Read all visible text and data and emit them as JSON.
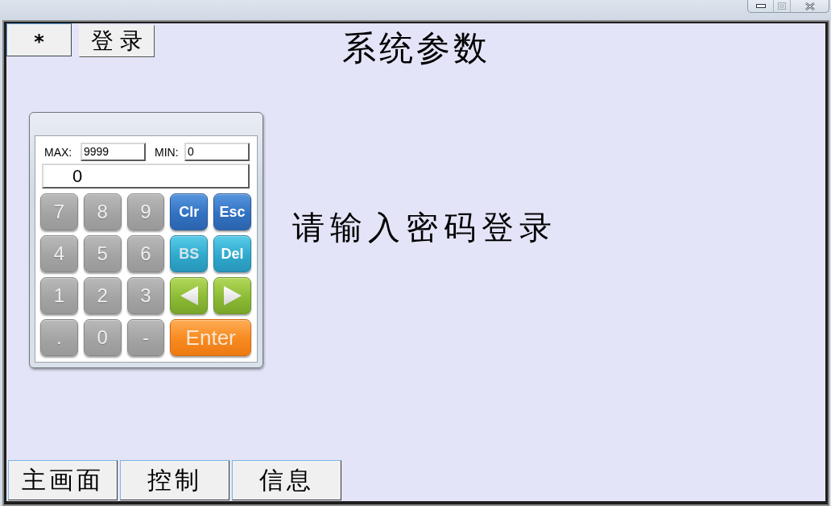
{
  "header": {
    "star_button": "*",
    "login_button": "登录",
    "title": "系统参数"
  },
  "keypad": {
    "max_label": "MAX:",
    "max_value": "9999",
    "min_label": "MIN:",
    "min_value": "0",
    "display": "0",
    "keys": [
      {
        "kind": "digit",
        "label": "7"
      },
      {
        "kind": "digit",
        "label": "8"
      },
      {
        "kind": "digit",
        "label": "9"
      },
      {
        "kind": "action",
        "label": "Clr"
      },
      {
        "kind": "action",
        "label": "Esc"
      },
      {
        "kind": "digit",
        "label": "4"
      },
      {
        "kind": "digit",
        "label": "5"
      },
      {
        "kind": "digit",
        "label": "6"
      },
      {
        "kind": "edit",
        "label": "BS"
      },
      {
        "kind": "edit",
        "label": "Del"
      },
      {
        "kind": "digit",
        "label": "1"
      },
      {
        "kind": "digit",
        "label": "2"
      },
      {
        "kind": "digit",
        "label": "3"
      },
      {
        "kind": "left"
      },
      {
        "kind": "right"
      },
      {
        "kind": "digit",
        "label": "."
      },
      {
        "kind": "digit",
        "label": "0"
      },
      {
        "kind": "digit",
        "label": "-"
      },
      {
        "kind": "enter",
        "label": "Enter"
      }
    ]
  },
  "message": "请输入密码登录",
  "tabs": [
    {
      "label": "主画面"
    },
    {
      "label": "控制"
    },
    {
      "label": "信息"
    }
  ]
}
